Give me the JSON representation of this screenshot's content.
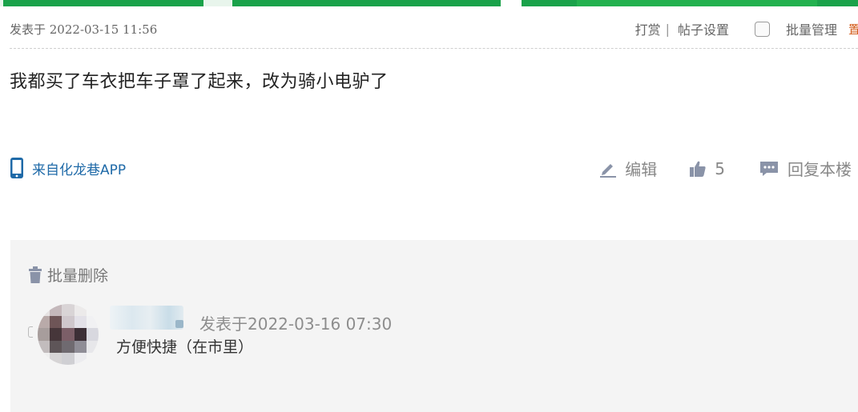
{
  "post": {
    "time_label": "发表于 2022-03-15 11:56",
    "content": "我都买了车衣把车子罩了起来，改为骑小电驴了",
    "source": "来自化龙巷APP"
  },
  "meta_actions": {
    "tip": "打赏",
    "separator": "|",
    "post_settings": "帖子设置",
    "batch_manage": "批量管理",
    "cut_text": "置"
  },
  "actions": {
    "edit": "编辑",
    "like_count": "5",
    "reply": "回复本楼"
  },
  "reply_panel": {
    "batch_delete": "批量删除",
    "replies": [
      {
        "time_label": "发表于2022-03-16 07:30",
        "text": "方便快捷（在市里）"
      }
    ]
  },
  "colors": {
    "banner_green": "#1aa24a",
    "link_blue": "#1f6aa8",
    "panel_bg": "#f4f4f4",
    "icon_gray": "#8a93a8"
  },
  "icons": [
    "phone-icon",
    "pencil-icon",
    "thumbs-up-icon",
    "comment-icon",
    "trash-icon"
  ]
}
